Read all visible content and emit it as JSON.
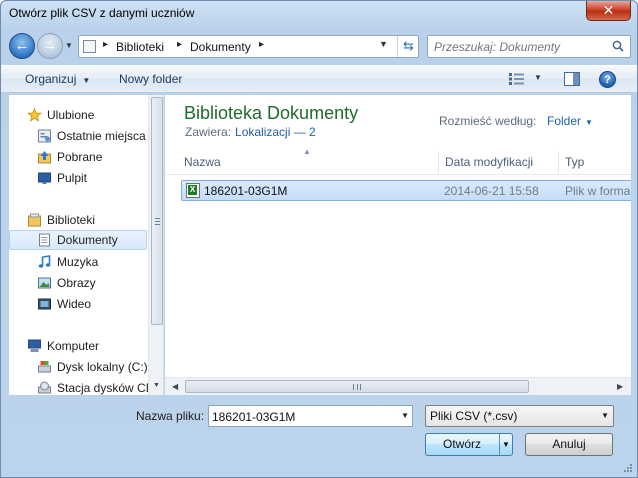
{
  "window": {
    "title": "Otwórz plik CSV z danymi uczniów",
    "close_glyph": "✕"
  },
  "address": {
    "crumbs": [
      "Biblioteki",
      "Dokumenty"
    ],
    "separator": "▸",
    "search_placeholder": "Przeszukaj: Dokumenty"
  },
  "toolbar": {
    "organize": "Organizuj",
    "new_folder": "Nowy folder",
    "help": "?"
  },
  "sidebar": {
    "items": [
      {
        "label": "Ulubione",
        "icon": "star-icon",
        "group": true
      },
      {
        "label": "Ostatnie miejsca",
        "icon": "recent-places-icon"
      },
      {
        "label": "Pobrane",
        "icon": "downloads-icon"
      },
      {
        "label": "Pulpit",
        "icon": "desktop-icon"
      },
      {
        "label": "Biblioteki",
        "icon": "libraries-icon",
        "group": true
      },
      {
        "label": "Dokumenty",
        "icon": "documents-icon",
        "selected": true
      },
      {
        "label": "Muzyka",
        "icon": "music-icon"
      },
      {
        "label": "Obrazy",
        "icon": "pictures-icon"
      },
      {
        "label": "Wideo",
        "icon": "video-icon"
      },
      {
        "label": "Komputer",
        "icon": "computer-icon",
        "group": true
      },
      {
        "label": "Dysk lokalny (C:)",
        "icon": "local-disk-icon"
      },
      {
        "label": "Stacja dysków CD",
        "icon": "cd-drive-icon"
      }
    ]
  },
  "library": {
    "title": "Biblioteka Dokumenty",
    "includes_label": "Zawiera:",
    "locations_link": "Lokalizacji — 2",
    "arrange_label": "Rozmieść według:",
    "arrange_value": "Folder"
  },
  "columns": {
    "name": "Nazwa",
    "modified": "Data modyfikacji",
    "type": "Typ"
  },
  "files": [
    {
      "name": "186201-03G1M",
      "modified": "2014-06-21 15:58",
      "type": "Plik w formacie CSV programu Microsoft Excel"
    }
  ],
  "bottom": {
    "filename_label": "Nazwa pliku:",
    "filename_value": "186201-03G1M",
    "filter_value": "Pliki CSV (*.csv)",
    "open_button": "Otwórz",
    "cancel_button": "Anuluj"
  },
  "colors": {
    "library_title": "#1e6c2a",
    "link": "#1f5fb3",
    "selection": "#c3dcf7"
  }
}
